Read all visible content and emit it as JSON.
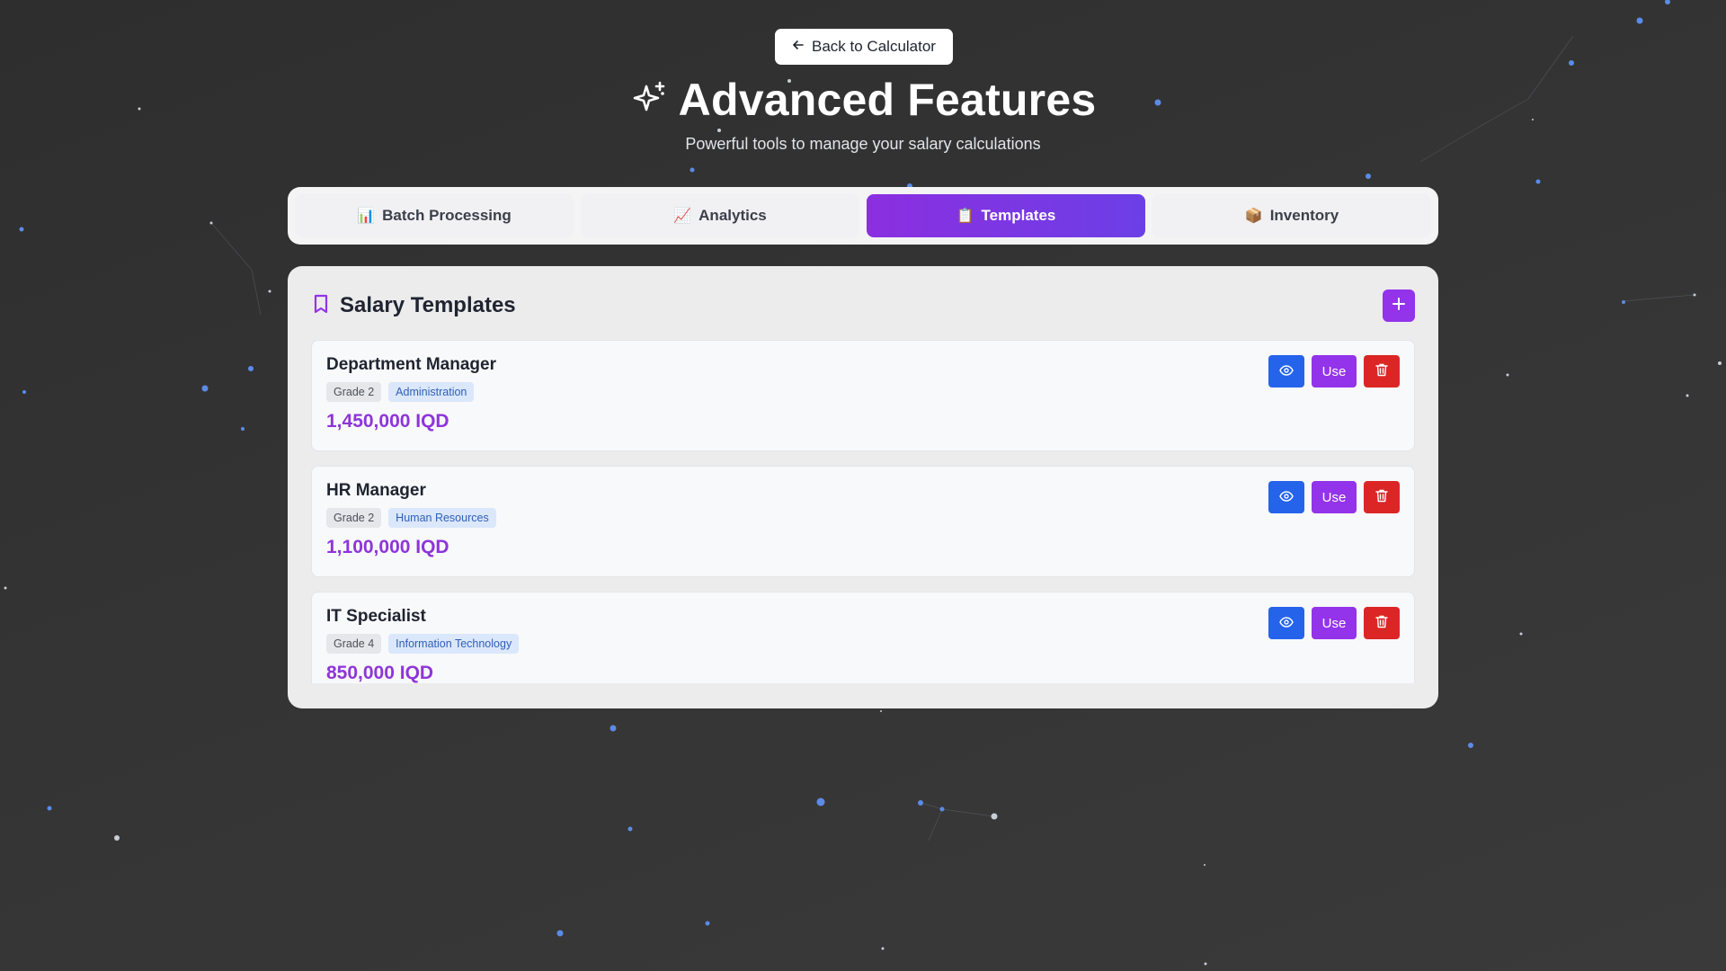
{
  "back_button": {
    "label": "Back to Calculator",
    "icon": "arrow-left-icon"
  },
  "header": {
    "title": "Advanced Features",
    "subtitle": "Powerful tools to manage your salary calculations",
    "icon": "sparkles-icon"
  },
  "tabs": [
    {
      "emoji": "📊",
      "label": "Batch Processing",
      "active": false
    },
    {
      "emoji": "📈",
      "label": "Analytics",
      "active": false
    },
    {
      "emoji": "📋",
      "label": "Templates",
      "active": true
    },
    {
      "emoji": "📦",
      "label": "Inventory",
      "active": false
    }
  ],
  "panel": {
    "title": "Salary Templates",
    "title_icon": "bookmark-icon",
    "add_icon": "plus-icon"
  },
  "templates": [
    {
      "name": "Department Manager",
      "grade": "Grade 2",
      "department": "Administration",
      "amount": "1,450,000 IQD"
    },
    {
      "name": "HR Manager",
      "grade": "Grade 2",
      "department": "Human Resources",
      "amount": "1,100,000 IQD"
    },
    {
      "name": "IT Specialist",
      "grade": "Grade 4",
      "department": "Information Technology",
      "amount": "850,000 IQD"
    }
  ],
  "card_actions": {
    "view_icon": "eye-icon",
    "use_label": "Use",
    "delete_icon": "trash-icon"
  },
  "colors": {
    "accent_purple": "#9333ea",
    "view_blue": "#2563eb",
    "delete_red": "#dc2626",
    "amount_purple": "#8e35d9"
  }
}
